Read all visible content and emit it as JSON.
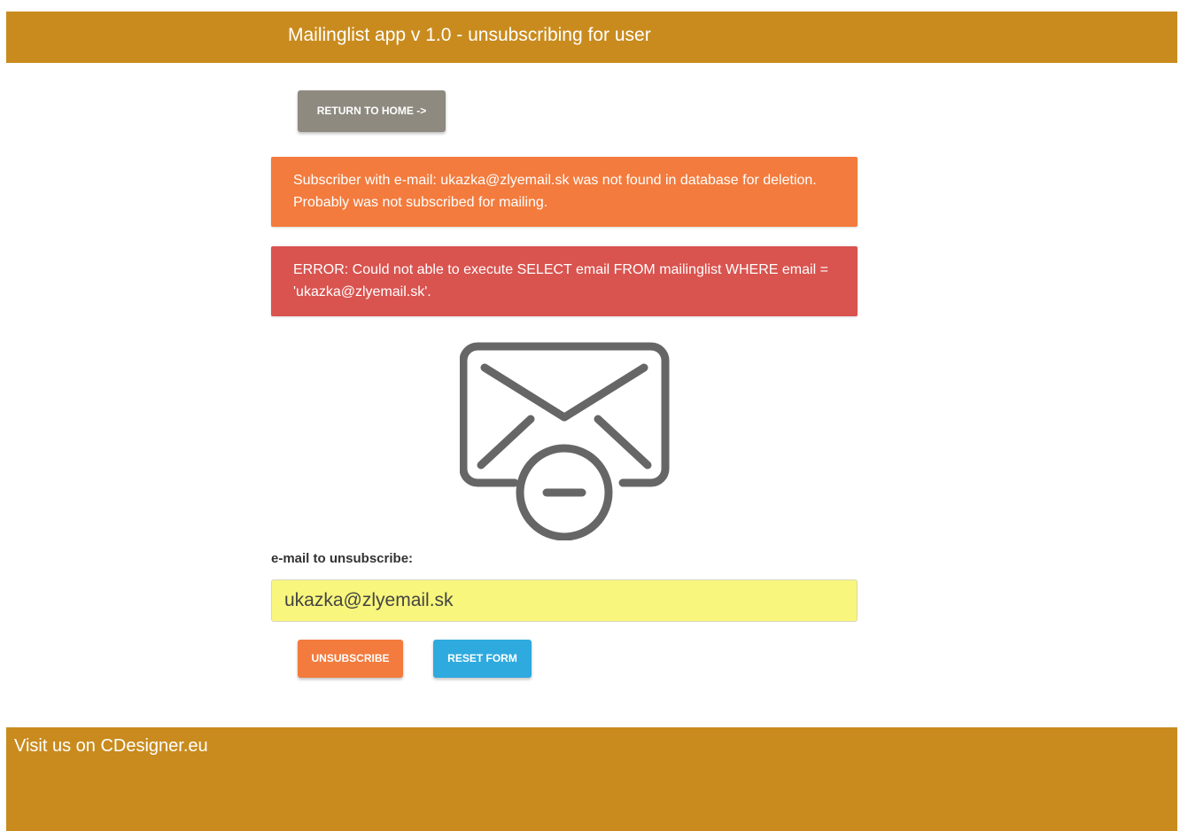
{
  "header": {
    "title": "Mailinglist app v 1.0 - unsubscribing for user"
  },
  "nav": {
    "return_home_label": "RETURN TO HOME ->"
  },
  "alerts": {
    "warning": "Subscriber with e-mail: ukazka@zlyemail.sk was not found in database for deletion. Probably was not subscribed for mailing.",
    "error": "ERROR: Could not able to execute SELECT email FROM mailinglist WHERE email = 'ukazka@zlyemail.sk'."
  },
  "icon": {
    "name": "envelope-minus-icon",
    "color": "#666666"
  },
  "form": {
    "email_label": "e-mail to unsubscribe:",
    "email_value": "ukazka@zlyemail.sk",
    "unsubscribe_label": "UNSUBSCRIBE",
    "reset_label": "RESET FORM"
  },
  "footer": {
    "text": "Visit us on CDesigner.eu"
  },
  "colors": {
    "brand": "#c98b1e",
    "warning": "#f37b3d",
    "danger": "#d9534f",
    "info": "#2eaadf",
    "neutral_button": "#8e8a80",
    "input_background": "#f8f67c"
  }
}
